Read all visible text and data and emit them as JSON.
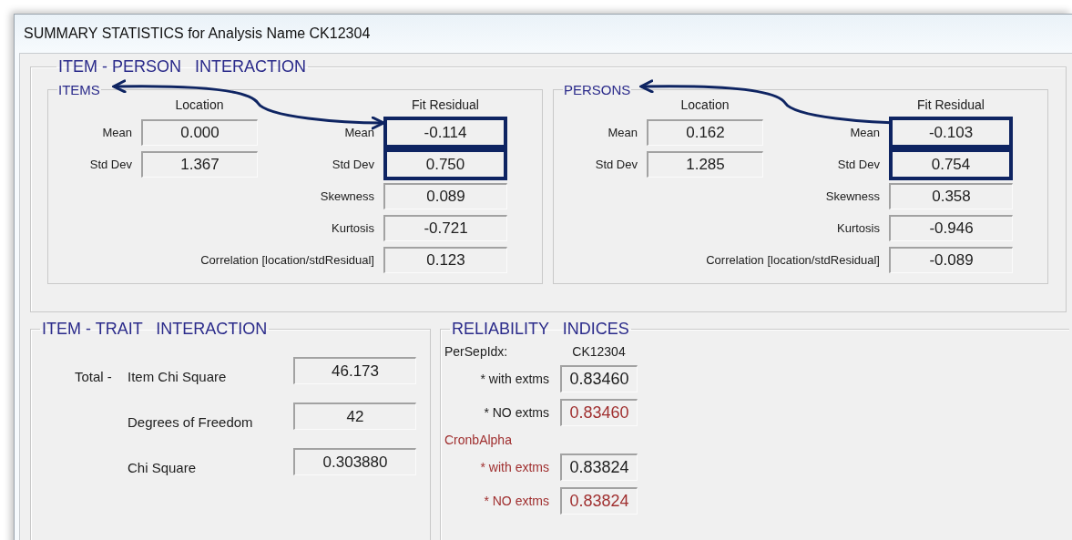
{
  "window": {
    "title": "SUMMARY STATISTICS for Analysis Name CK12304"
  },
  "item_person_interaction": {
    "title": "ITEM - PERSON   INTERACTION",
    "panels": [
      {
        "title": "ITEMS",
        "location_header": "Location",
        "fit_header": "Fit Residual",
        "location": [
          {
            "label": "Mean",
            "value": "0.000"
          },
          {
            "label": "Std Dev",
            "value": "1.367"
          }
        ],
        "fit_residual": [
          {
            "label": "Mean",
            "value": "-0.114",
            "highlighted": true
          },
          {
            "label": "Std Dev",
            "value": "0.750",
            "highlighted": true
          },
          {
            "label": "Skewness",
            "value": "0.089",
            "highlighted": false
          },
          {
            "label": "Kurtosis",
            "value": "-0.721",
            "highlighted": false
          },
          {
            "label": "Correlation [location/stdResidual]",
            "value": "0.123",
            "highlighted": false
          }
        ]
      },
      {
        "title": "PERSONS",
        "location_header": "Location",
        "fit_header": "Fit Residual",
        "location": [
          {
            "label": "Mean",
            "value": "0.162"
          },
          {
            "label": "Std Dev",
            "value": "1.285"
          }
        ],
        "fit_residual": [
          {
            "label": "Mean",
            "value": "-0.103",
            "highlighted": true
          },
          {
            "label": "Std Dev",
            "value": "0.754",
            "highlighted": true
          },
          {
            "label": "Skewness",
            "value": "0.358",
            "highlighted": false
          },
          {
            "label": "Kurtosis",
            "value": "-0.946",
            "highlighted": false
          },
          {
            "label": "Correlation [location/stdResidual]",
            "value": "-0.089",
            "highlighted": false
          }
        ]
      }
    ]
  },
  "item_trait_interaction": {
    "title": "ITEM - TRAIT   INTERACTION",
    "rows": [
      {
        "prefix": "Total -",
        "label": "Item Chi Square",
        "value": "46.173"
      },
      {
        "label": "Degrees of Freedom",
        "value": "42"
      },
      {
        "label": "Chi Square",
        "value": "0.303880"
      }
    ]
  },
  "reliability_indices": {
    "title": "RELIABILITY   INDICES",
    "column_header": "CK12304",
    "groups": [
      {
        "label": "PerSepIdx:",
        "color": "#202020",
        "rows": [
          {
            "label": "* with extms",
            "value": "0.83460",
            "color": "#202020"
          },
          {
            "label": "* NO extms",
            "value": "0.83460",
            "color": "#a03030"
          }
        ]
      },
      {
        "label": "CronbAlpha",
        "color": "#a03030",
        "rows": [
          {
            "label": "* with extms",
            "value": "0.83824",
            "color": "#202020"
          },
          {
            "label": "* NO extms",
            "value": "0.83824",
            "color": "#a03030"
          }
        ]
      }
    ]
  }
}
